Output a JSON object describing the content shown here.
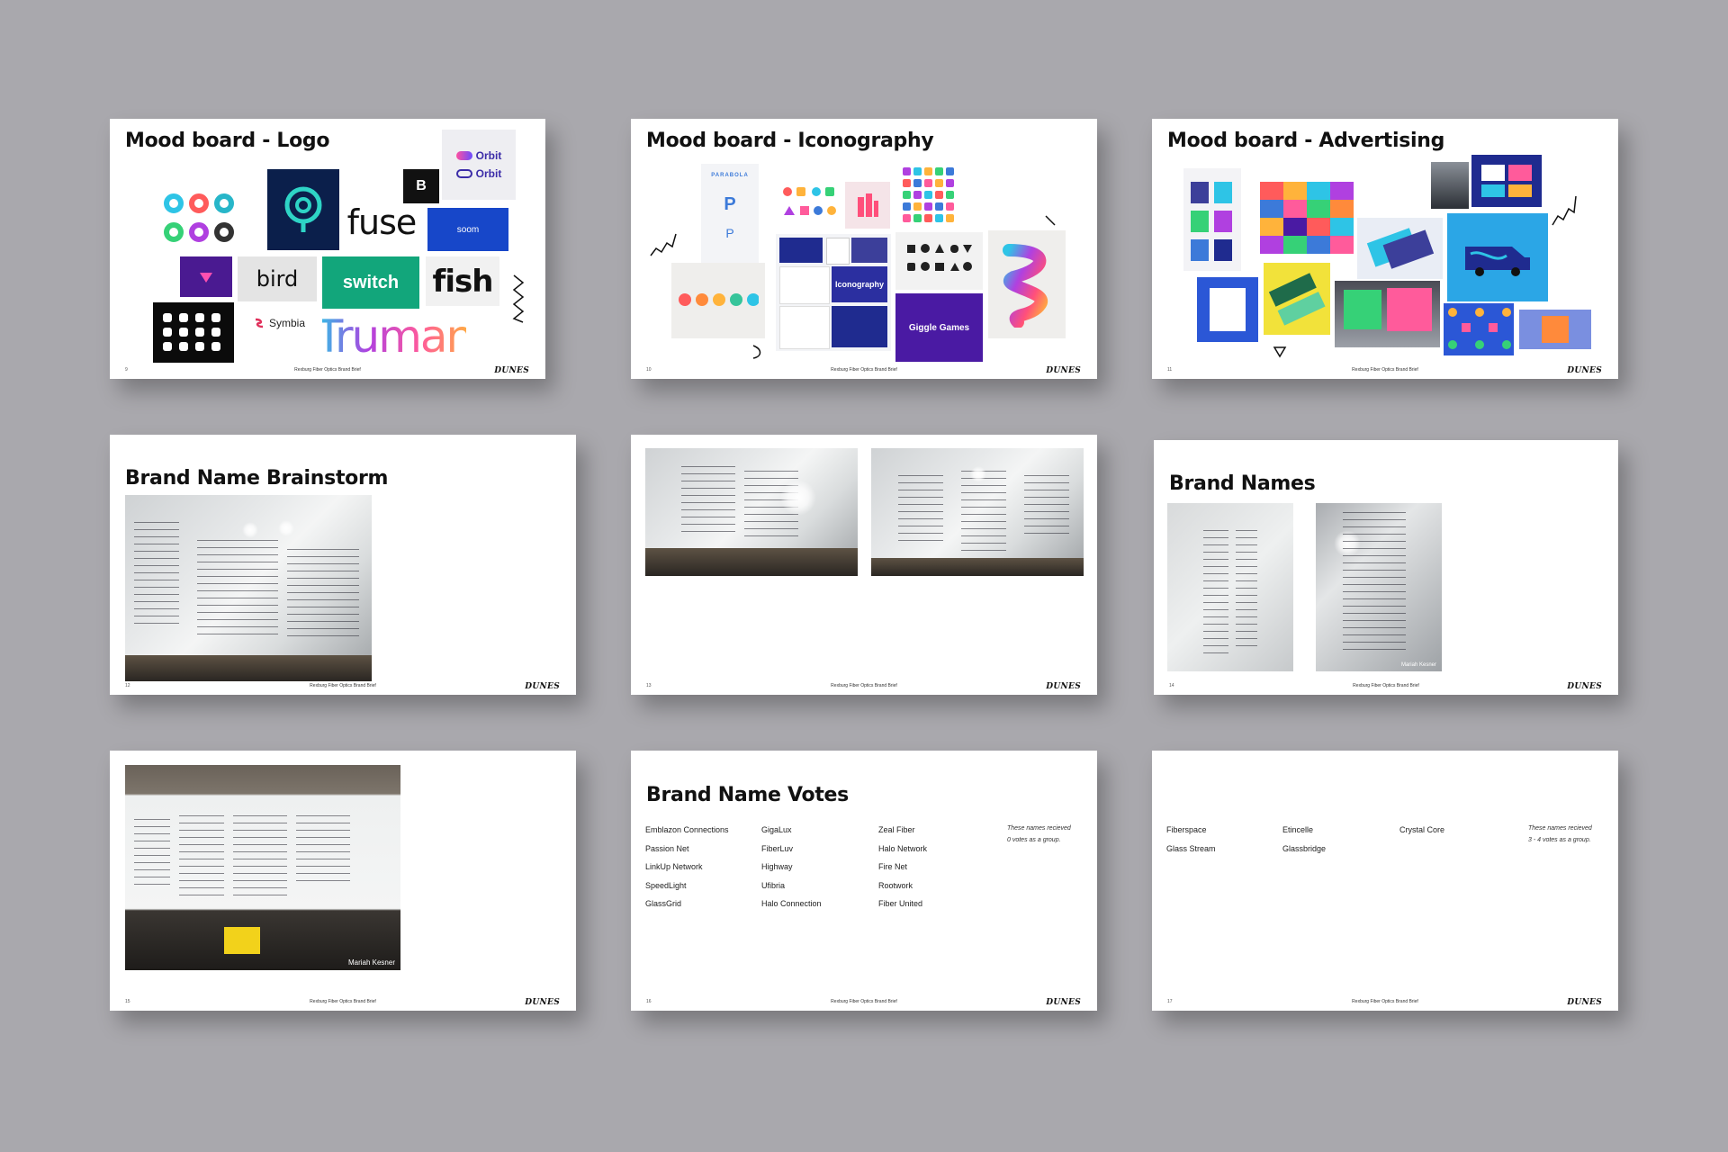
{
  "slides": {
    "s1": {
      "title": "Mood board - Logo",
      "page": "9",
      "footer": "Rexburg Fiber Optics Brand Brief",
      "logo": "DUNES",
      "words": {
        "fuse": "fuse",
        "bird": "bird",
        "switch": "switch",
        "fish": "fish",
        "truman": "Truman",
        "orbit1": "Orbit",
        "orbit2": "Orbit",
        "symbia": "Symbia",
        "soon": "soom"
      }
    },
    "s2": {
      "title": "Mood board - Iconography",
      "page": "10",
      "footer": "Rexburg Fiber Optics Brand Brief",
      "logo": "DUNES",
      "words": {
        "iconography": "Iconography",
        "giggle": "Giggle Games",
        "parabola": "PARABOLA"
      }
    },
    "s3": {
      "title": "Mood board - Advertising",
      "page": "11",
      "footer": "Rexburg Fiber Optics Brand Brief",
      "logo": "DUNES"
    },
    "s4": {
      "title": "Brand Name Brainstorm",
      "page": "12",
      "footer": "Rexburg Fiber Optics Brand Brief",
      "logo": "DUNES"
    },
    "s5": {
      "page": "13",
      "footer": "Rexburg Fiber Optics Brand Brief",
      "logo": "DUNES"
    },
    "s6": {
      "title": "Brand Names",
      "page": "14",
      "footer": "Rexburg Fiber Optics Brand Brief",
      "logo": "DUNES",
      "credit": "Mariah Kesner"
    },
    "s7": {
      "page": "15",
      "footer": "Rexburg Fiber Optics Brand Brief",
      "logo": "DUNES",
      "credit": "Mariah Kesner"
    },
    "s8": {
      "title": "Brand Name Votes",
      "page": "16",
      "footer": "Rexburg Fiber Optics Brand Brief",
      "logo": "DUNES",
      "col1": [
        "Emblazon Connections",
        "Passion Net",
        "LinkUp Network",
        "SpeedLight",
        "GlassGrid"
      ],
      "col2": [
        "GigaLux",
        "FiberLuv",
        "Highway",
        "Ufibria",
        "Halo Connection"
      ],
      "col3": [
        "Zeal Fiber",
        "Halo Network",
        "Fire Net",
        "Rootwork",
        "Fiber United"
      ],
      "note1": "These names recieved",
      "note2": "0 votes as a group."
    },
    "s9": {
      "page": "17",
      "footer": "Rexburg Fiber Optics Brand Brief",
      "logo": "DUNES",
      "col1": [
        "Fiberspace",
        "Glass Stream"
      ],
      "col2": [
        "Etincelle",
        "Glassbridge"
      ],
      "col3": [
        "Crystal Core"
      ],
      "note1": "These names recieved",
      "note2": "3 - 4 votes as a group."
    }
  }
}
